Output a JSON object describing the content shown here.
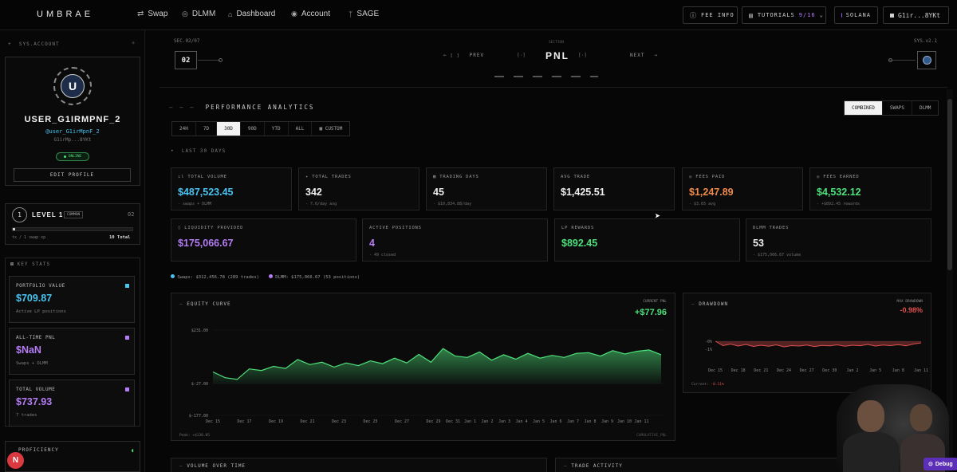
{
  "nav": {
    "logo": "UMBRAE",
    "links": [
      {
        "label": "Swap",
        "icon": "swap-arrows-icon"
      },
      {
        "label": "DLMM",
        "icon": "dlmm-coin-icon"
      },
      {
        "label": "Dashboard",
        "icon": "home-icon"
      },
      {
        "label": "Account",
        "icon": "account-icon"
      },
      {
        "label": "SAGE",
        "icon": "sage-icon"
      }
    ],
    "fee_info": "FEE INFO",
    "tutorials": "TUTORIALS",
    "tutorials_count": "9/16",
    "network": "SOLANA",
    "wallet": "G1ir...8YKt"
  },
  "sidebar": {
    "section_label": "SYS.ACCOUNT",
    "avatar_letter": "U",
    "username": "USER_G1IRMPNF_2",
    "handle": "@user_G1irMpnF_2",
    "wallet_short": "G1irMp...8YKt",
    "status": "ONLINE",
    "edit_profile": "EDIT PROFILE",
    "level_number": "1",
    "level_label": "LEVEL 1",
    "level_badge": "COMMON",
    "level_right": "02",
    "xp_text": "tx / 1 swap xp",
    "xp_total": "10 Total",
    "xp_progress": 0.02,
    "key_stats_title": "KEY STATS",
    "stats": [
      {
        "label": "PORTFOLIO VALUE",
        "value": "$709.87",
        "sub": "Active LP positions",
        "color": "#49c3f0"
      },
      {
        "label": "ALL-TIME PNL",
        "value": "$NaN",
        "sub": "Swaps + DLMM",
        "color": "#b57cf5"
      },
      {
        "label": "TOTAL VOLUME",
        "value": "$737.93",
        "sub": "7 trades",
        "color": "#b57cf5"
      }
    ],
    "proficiency": "PROFICIENCY",
    "notif_letter": "N"
  },
  "header": {
    "sec_code": "SEC.02/07",
    "sec_num": "02",
    "section_label": "SECTION",
    "prev": "PREV",
    "title": "PNL",
    "next": "NEXT",
    "sys_code": "SYS.v2.1"
  },
  "analytics": {
    "title": "PERFORMANCE ANALYTICS",
    "modes": [
      "COMBINED",
      "SWAPS",
      "DLMM"
    ],
    "active_mode": 0,
    "ranges": [
      "24H",
      "7D",
      "30D",
      "90D",
      "YTD",
      "ALL"
    ],
    "active_range": 2,
    "custom": "CUSTOM",
    "period_label": "LAST 30 DAYS",
    "kpis_row1": [
      {
        "label": "TOTAL VOLUME",
        "value": "$487,523.45",
        "sub": "swaps + DLMM",
        "color": "#49c3f0",
        "icon": "chart-bars-icon"
      },
      {
        "label": "TOTAL TRADES",
        "value": "342",
        "sub": "7.6/day avg",
        "color": "#f0f0f0",
        "icon": "sparkle-icon"
      },
      {
        "label": "TRADING DAYS",
        "value": "45",
        "sub": "$10,834.88/day",
        "color": "#f0f0f0",
        "icon": "calendar-icon"
      },
      {
        "label": "AVG TRADE",
        "value": "$1,425.51",
        "sub": "",
        "color": "#f0f0f0",
        "icon": ""
      },
      {
        "label": "FEES PAID",
        "value": "$1,247.89",
        "sub": "$3.65 avg",
        "color": "#f08a4b",
        "icon": "coin-icon"
      },
      {
        "label": "FEES EARNED",
        "value": "$4,532.12",
        "sub": "+$892.45 rewards",
        "color": "#4ee07a",
        "icon": "coin-icon"
      }
    ],
    "kpis_row2": [
      {
        "label": "LIQUIDITY PROVIDED",
        "value": "$175,066.67",
        "sub": "",
        "color": "#b57cf5",
        "icon": "droplet-icon"
      },
      {
        "label": "ACTIVE POSITIONS",
        "value": "4",
        "sub": "49 closed",
        "color": "#b57cf5",
        "icon": ""
      },
      {
        "label": "LP REWARDS",
        "value": "$892.45",
        "sub": "",
        "color": "#4ee07a",
        "icon": ""
      },
      {
        "label": "DLMM TRADES",
        "value": "53",
        "sub": "$175,066.67 volume",
        "color": "#f0f0f0",
        "icon": ""
      }
    ],
    "legend": [
      {
        "text": "Swaps: $312,456.78 (289 trades)",
        "color": "#49c3f0"
      },
      {
        "text": "DLMM: $175,066.67 (53 positions)",
        "color": "#b57cf5"
      }
    ]
  },
  "equity": {
    "title": "EQUITY CURVE",
    "current_label": "CURRENT PNL",
    "current_value": "+$77.96",
    "peak_label": "Peak: +$130.05",
    "footer_right": "CUMULATIVE_PNL",
    "y_ticks": [
      "$231.00",
      "$-27.00",
      "$-177.00"
    ],
    "x_ticks": [
      "Dec 15",
      "Dec 17",
      "Dec 19",
      "Dec 21",
      "Dec 23",
      "Dec 25",
      "Dec 27",
      "Dec 29",
      "Dec 31",
      "Jan 1",
      "Jan 2",
      "Jan 3",
      "Jan 4",
      "Jan 5",
      "Jan 6",
      "Jan 7",
      "Jan 8",
      "Jan 9",
      "Jan 10",
      "Jan 11"
    ],
    "color": "#4ee07a"
  },
  "drawdown": {
    "title": "DRAWDOWN",
    "max_label": "MAX DRAWDOWN",
    "max_value": "-0.98%",
    "y_ticks": [
      "-0%",
      "-1%"
    ],
    "x_ticks": [
      "Dec 15",
      "Dec 18",
      "Dec 21",
      "Dec 24",
      "Dec 27",
      "Dec 30",
      "Jan 2",
      "Jan 5",
      "Jan 8",
      "Jan 11"
    ],
    "current_label": "Current:",
    "current_value": "-0.11%",
    "color": "#e05050"
  },
  "bottom": {
    "volume_title": "VOLUME OVER TIME",
    "activity_title": "TRADE ACTIVITY"
  },
  "debug": "Debug"
}
